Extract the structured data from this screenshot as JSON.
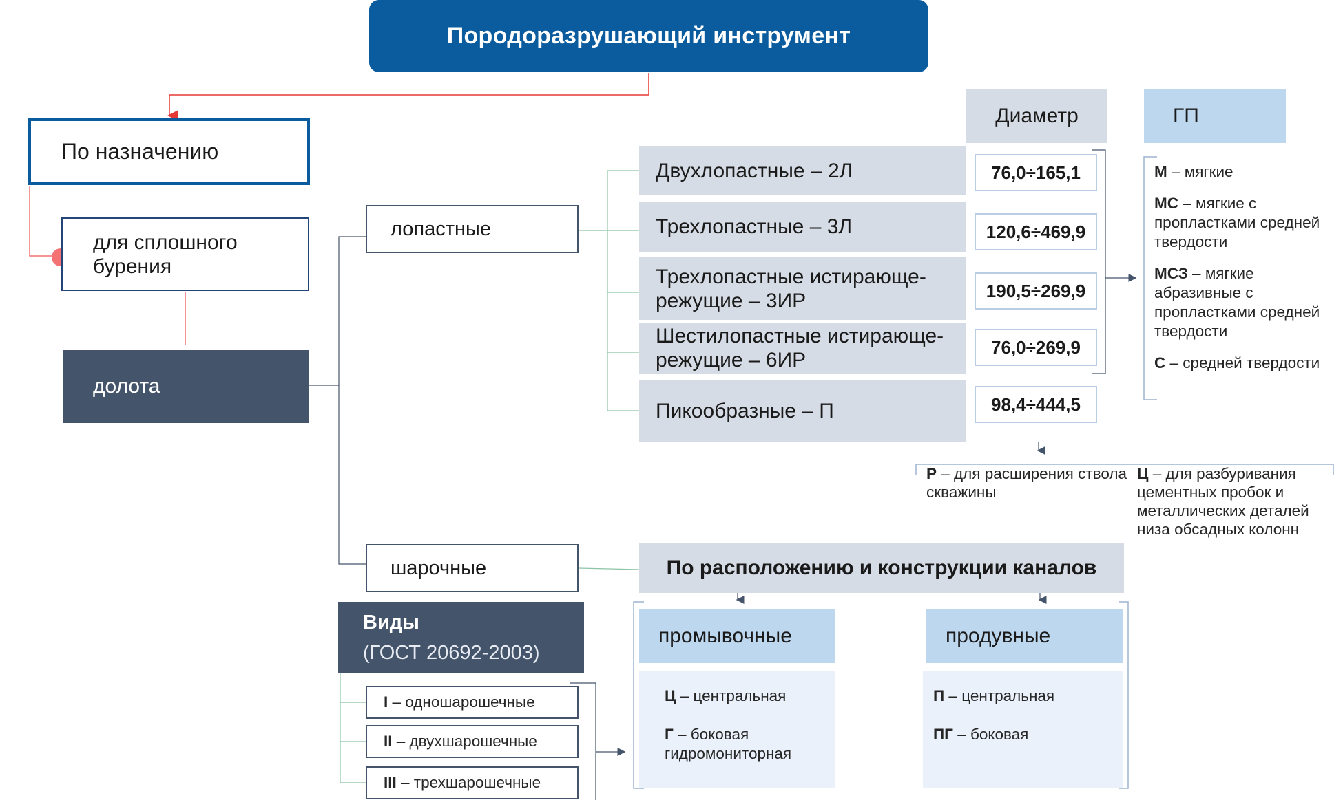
{
  "title": "Породоразрушающий инструмент",
  "purpose": "По назначению",
  "solid_drilling": "для сплошного бурения",
  "bits": "долота",
  "blade": "лопастные",
  "roller": "шарочные",
  "headers": {
    "diameter": "Диаметр",
    "gp": "ГП"
  },
  "blade_types": [
    {
      "name": "Двухлопастные – 2Л",
      "diameter": "76,0÷165,1"
    },
    {
      "name": "Трехлопастные – 3Л",
      "diameter": "120,6÷469,9"
    },
    {
      "name": "Трехлопастные истирающе-режущие – 3ИР",
      "diameter": "190,5÷269,9"
    },
    {
      "name": "Шестилопастные истирающе-режущие – 6ИР",
      "diameter": "76,0÷269,9"
    },
    {
      "name": "Пикообразные – П",
      "diameter": "98,4÷444,5"
    }
  ],
  "rock_hardness": [
    {
      "code": "М",
      "desc": " – мягкие"
    },
    {
      "code": "МС",
      "desc": " – мягкие с пропластками средней твердости"
    },
    {
      "code": "МСЗ",
      "desc": " – мягкие абразивные с пропластками средней твердости"
    },
    {
      "code": "С",
      "desc": " – средней твердости"
    }
  ],
  "purposes_extra": [
    {
      "code": "Р",
      "desc": " – для расширения ствола скважины"
    },
    {
      "code": "Ц",
      "desc": " – для разбуривания цементных пробок и металлических деталей низа обсадных колонн"
    }
  ],
  "channels": {
    "title": "По расположению и конструкции каналов",
    "flushing": {
      "label": "промывочные",
      "items": [
        {
          "code": "Ц",
          "desc": " – центральная"
        },
        {
          "code": "Г",
          "desc": " – боковая гидромониторная"
        }
      ]
    },
    "blowing": {
      "label": "продувные",
      "items": [
        {
          "code": "П",
          "desc": " – центральная"
        },
        {
          "code": "ПГ",
          "desc": " – боковая"
        }
      ]
    }
  },
  "types": {
    "title": "Виды",
    "standard": "(ГОСТ 20692-2003)",
    "items": [
      {
        "code": "I",
        "desc": " – одношарошечные"
      },
      {
        "code": "II",
        "desc": " – двухшарошечные"
      },
      {
        "code": "III",
        "desc": " – трехшарошечные"
      }
    ]
  },
  "colors": {
    "title_bg": "#0a5c9e",
    "dark_box": "#44546a",
    "gray_row": "#d6dce5",
    "light_blue": "#bdd7ee",
    "pale_blue": "#eaf1fa",
    "red_connector": "#f47174",
    "green_connector": "#8cc4a4"
  }
}
